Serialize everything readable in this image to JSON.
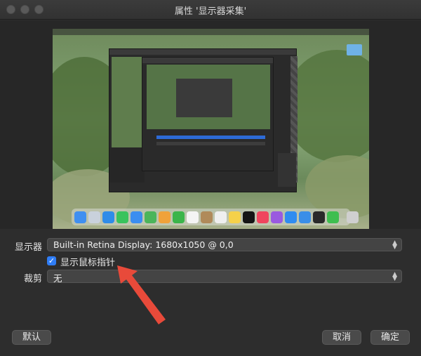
{
  "window": {
    "title": "属性 '显示器采集'"
  },
  "form": {
    "display_label": "显示器",
    "display_value": "Built-in Retina Display: 1680x1050 @ 0,0",
    "show_cursor_label": "显示鼠标指针",
    "show_cursor_checked": true,
    "crop_label": "裁剪",
    "crop_value": "无"
  },
  "buttons": {
    "defaults": "默认",
    "cancel": "取消",
    "ok": "确定"
  },
  "colors": {
    "accent": "#2f7df6",
    "annotation_arrow": "#e84a3a"
  },
  "icons": [
    "close-icon",
    "minimize-icon",
    "zoom-icon",
    "checkmark-icon",
    "chevron-up-down-icon",
    "annotation-arrow-icon"
  ]
}
